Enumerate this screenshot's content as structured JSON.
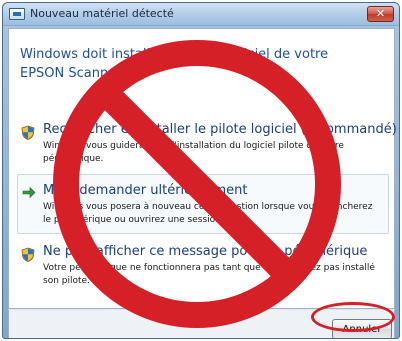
{
  "window": {
    "title": "Nouveau matériel détecté",
    "close_glyph": "✕"
  },
  "header": {
    "text": "Windows doit installer le pilote logiciel de votre EPSON Scanner"
  },
  "options": [
    {
      "icon": "shield-icon",
      "title": "Rechercher et installer le pilote logiciel (recommandé)",
      "description": "Windows vous guidera dans l'installation du logiciel pilote de votre périphérique."
    },
    {
      "icon": "green-arrow-icon",
      "title": "Me redemander ultérieurement",
      "description": "Windows vous posera à nouveau cette question lorsque vous brancherez le périphérique ou ouvrirez une session."
    },
    {
      "icon": "shield-icon",
      "title": "Ne plus afficher ce message pour ce périphérique",
      "description": "Votre périphérique ne fonctionnera pas tant que vous n'aurez pas installé son pilote."
    }
  ],
  "footer": {
    "cancel_label": "Annuler"
  },
  "overlay": {
    "prohibition_color": "#d42026",
    "highlight_color": "#d42026"
  }
}
